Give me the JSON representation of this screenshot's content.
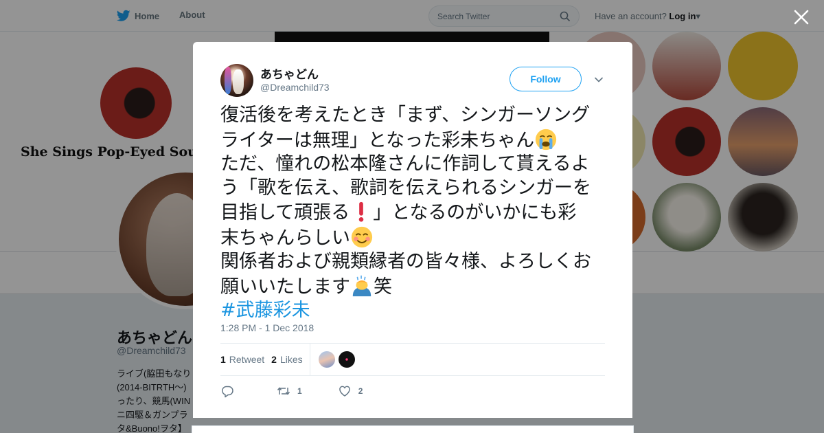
{
  "topbar": {
    "home_label": "Home",
    "about_label": "About",
    "search_placeholder": "Search Twitter",
    "have_account": "Have an account?",
    "login_label": "Log in"
  },
  "profile": {
    "banner_title": "She Sings Pop-Eyed Sou",
    "name": "あちゃどん",
    "handle": "@Dreamchild73",
    "bio_lines": [
      "ライブ(脇田もなり",
      "(2014-BITRTH～)",
      "ったり、競馬(WIN",
      "ニ四駆＆ガンプラ",
      "タ&Buono!ヲタ】"
    ]
  },
  "tweet": {
    "author_name": "あちゃどん",
    "author_handle": "@Dreamchild73",
    "follow_label": "Follow",
    "lines": [
      "復活後を考えたとき「まず、シンガーソング",
      "ライターは無理」となった彩未ちゃん",
      "ただ、憧れの松本隆さんに作詞して貰えるよ",
      "う「歌を伝え、歌詞を伝えられるシンガーを",
      "目指して頑張る",
      "」となるのがいかにも彩",
      "末ちゃんらしい",
      "関係者および親類縁者の皆々様、よろしくお",
      "願いいたします",
      "笑"
    ],
    "hashtag": "#武藤彩未",
    "timestamp": "1:28 PM - 1 Dec 2018",
    "retweet_count": "1",
    "retweet_label": "Retweet",
    "like_count": "2",
    "like_label": "Likes",
    "action_retweet_count": "1",
    "action_like_count": "2"
  },
  "colors": {
    "accent": "#1da1f2",
    "hashtag": "#1b95e0",
    "muted": "#657786"
  },
  "icons": {
    "twitter": "twitter-bird-icon",
    "search": "search-icon",
    "close": "close-icon",
    "caret": "chevron-down-icon",
    "reply": "reply-icon",
    "retweet": "retweet-icon",
    "like": "heart-icon",
    "emoji1": "loudly-crying-face-emoji",
    "emoji2": "red-exclamation-emoji",
    "emoji3": "smiling-face-emoji",
    "emoji4": "person-bowing-emoji"
  }
}
